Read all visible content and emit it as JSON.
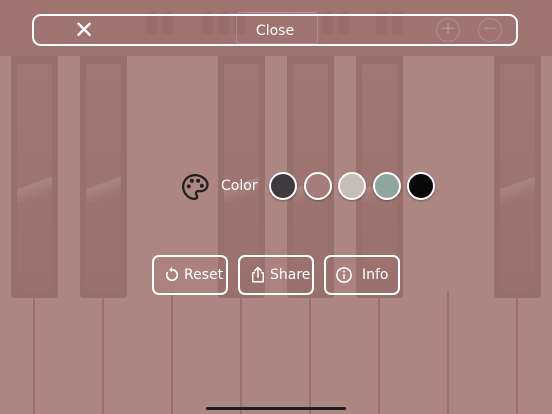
{
  "header": {
    "close_label": "Close",
    "close_icon": "x-icon"
  },
  "color_picker": {
    "label": "Color",
    "icon": "palette-icon",
    "swatches": [
      {
        "name": "dark-gray",
        "color": "#3f3a40"
      },
      {
        "name": "rose",
        "color": "#a57c79"
      },
      {
        "name": "beige",
        "color": "#c7bfb5"
      },
      {
        "name": "sage",
        "color": "#8fa59d"
      },
      {
        "name": "black",
        "color": "#080808"
      }
    ]
  },
  "actions": {
    "reset_label": "Reset",
    "share_label": "Share",
    "info_label": "Info"
  },
  "colors": {
    "background": "#a87e79",
    "keys": "#98706b",
    "overlay_text": "#ffffff"
  }
}
